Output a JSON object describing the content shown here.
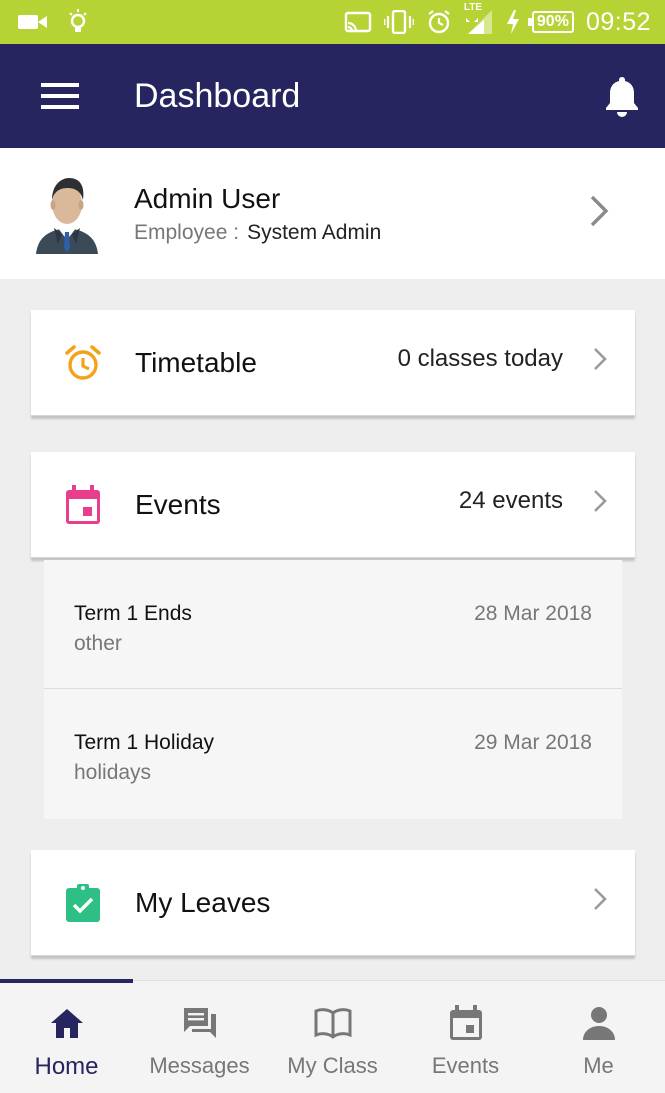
{
  "status_bar": {
    "battery": "90%",
    "time": "09:52",
    "network_label": "LTE",
    "icons": [
      "video-camera-icon",
      "lightbulb-icon",
      "cast-icon",
      "vibrate-icon",
      "alarm-icon",
      "signal-icon",
      "charging-icon",
      "battery-icon"
    ]
  },
  "app_bar": {
    "title": "Dashboard",
    "menu_icon": "hamburger-menu-icon",
    "notification_icon": "bell-icon",
    "background": "#27255f"
  },
  "profile": {
    "name": "Admin User",
    "role_label": "Employee :",
    "role_value": "System Admin"
  },
  "cards": {
    "timetable": {
      "title": "Timetable",
      "value": "0 classes today",
      "icon": "alarm-clock-icon",
      "icon_color": "#f5a21b"
    },
    "events": {
      "title": "Events",
      "value": "24 events",
      "icon": "calendar-icon",
      "icon_color": "#e83e8c"
    },
    "leaves": {
      "title": "My Leaves",
      "value": "",
      "icon": "clipboard-check-icon",
      "icon_color": "#2dbf84"
    }
  },
  "events_list": [
    {
      "title": "Term 1 Ends",
      "category": "other",
      "date": "28 Mar 2018"
    },
    {
      "title": "Term 1 Holiday",
      "category": "holidays",
      "date": "29 Mar 2018"
    }
  ],
  "bottom_nav": {
    "active": "Home",
    "items": [
      {
        "label": "Home",
        "icon": "home-icon"
      },
      {
        "label": "Messages",
        "icon": "messages-icon"
      },
      {
        "label": "My Class",
        "icon": "book-icon"
      },
      {
        "label": "Events",
        "icon": "calendar-icon"
      },
      {
        "label": "Me",
        "icon": "person-icon"
      }
    ]
  },
  "colors": {
    "status_bar": "#b5d334",
    "primary": "#27255f",
    "background": "#eeeeee"
  }
}
